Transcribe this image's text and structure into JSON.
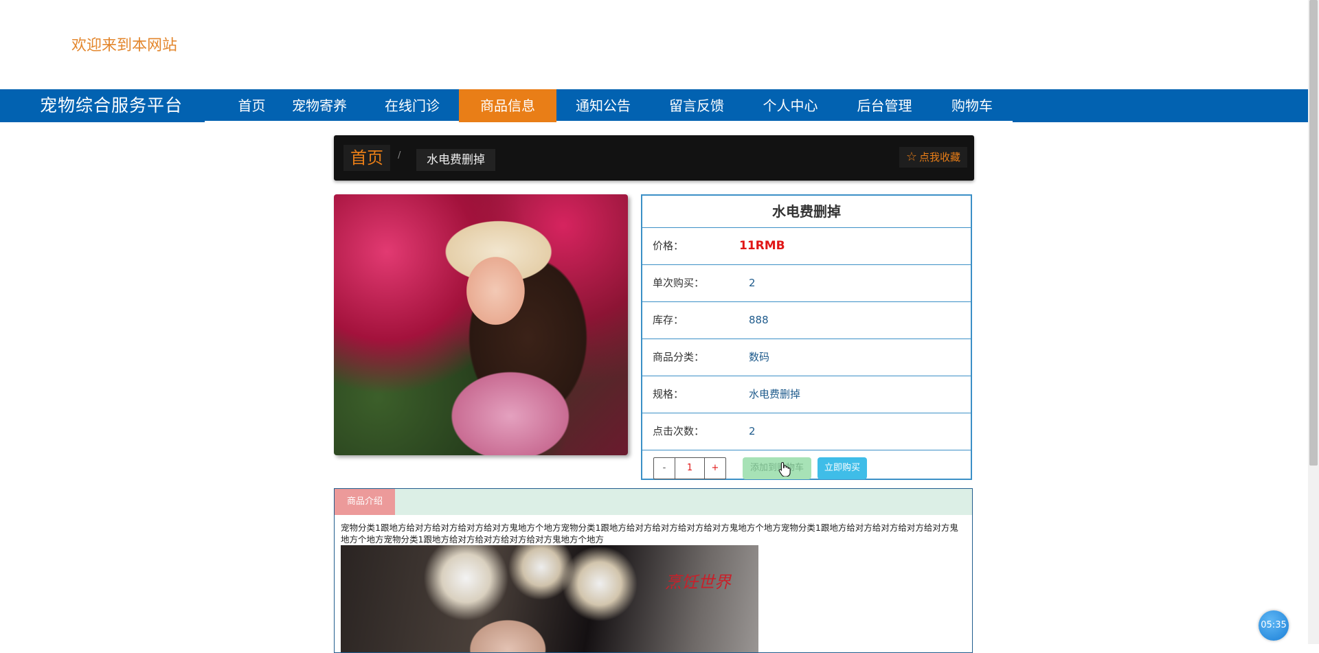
{
  "header": {
    "welcome": "欢迎来到本网站"
  },
  "navbar": {
    "brand": "宠物综合服务平台",
    "items": [
      {
        "label": "首页"
      },
      {
        "label": "宠物寄养"
      },
      {
        "label": "在线门诊"
      },
      {
        "label": "商品信息",
        "active": true
      },
      {
        "label": "通知公告"
      },
      {
        "label": "留言反馈"
      },
      {
        "label": "个人中心"
      },
      {
        "label": "后台管理"
      },
      {
        "label": "购物车"
      }
    ]
  },
  "breadcrumb": {
    "home": "首页",
    "separator": "/",
    "current": "水电费删掉",
    "favorite_label": "点我收藏",
    "favorite_icon": "star-outline-icon"
  },
  "product": {
    "name": "水电费删掉",
    "rows": [
      {
        "label": "价格：",
        "value": "11RMB"
      },
      {
        "label": "单次购买：",
        "value": "2"
      },
      {
        "label": "库存：",
        "value": "888"
      },
      {
        "label": "商品分类：",
        "value": "数码"
      },
      {
        "label": "规格：",
        "value": "水电费删掉"
      },
      {
        "label": "点击次数：",
        "value": "2"
      }
    ],
    "quantity": {
      "minus": "-",
      "value": "1",
      "plus": "+"
    },
    "add_to_cart": "添加到购物车",
    "buy_now": "立即购买"
  },
  "description": {
    "tab": "商品介绍",
    "text": "宠物分类1跟地方给对方给对方给对方给对方鬼地方个地方宠物分类1跟地方给对方给对方给对方给对方鬼地方个地方宠物分类1跟地方给对方给对方给对方给对方鬼地方个地方宠物分类1跟地方给对方给对方给对方给对方鬼地方个地方",
    "image_logo": "烹饪世界"
  },
  "timer": {
    "label": "05:35"
  },
  "colors": {
    "nav_bg": "#0262b1",
    "accent_orange": "#e97e17",
    "price_red": "#e01616",
    "panel_border": "#3a8fc6",
    "buy_button": "#3fbde8",
    "cart_button": "#a7e2b6"
  }
}
